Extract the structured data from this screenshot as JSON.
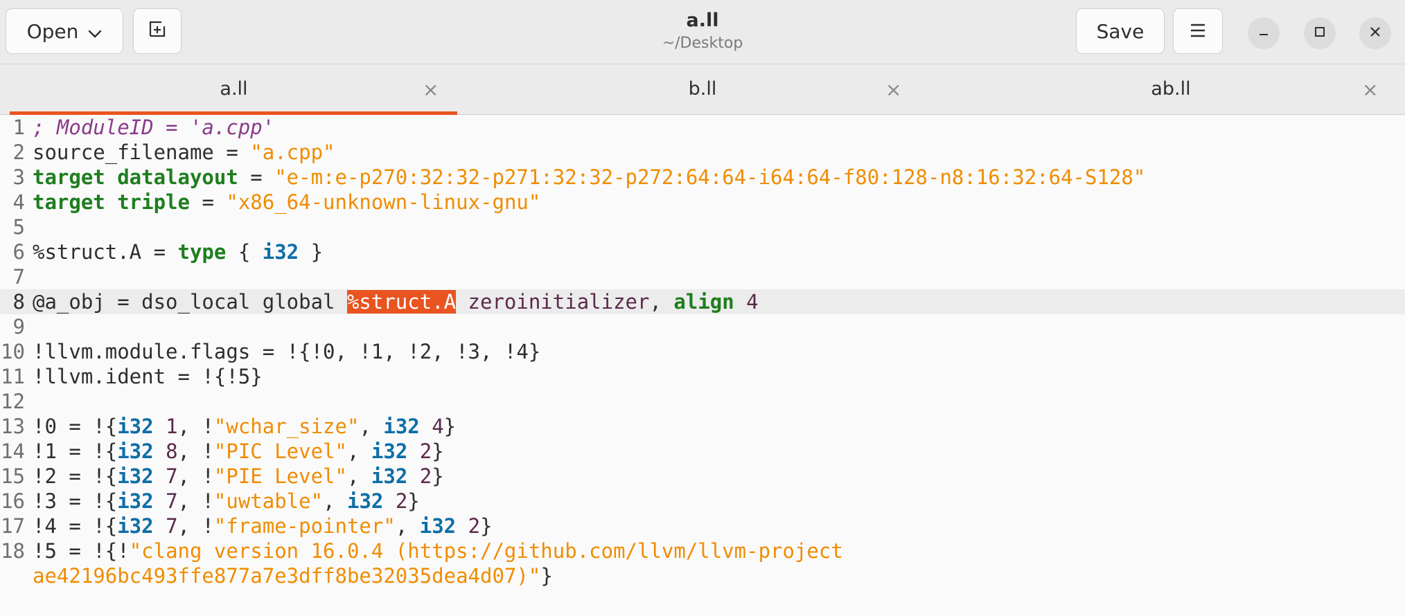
{
  "window": {
    "title": "a.ll",
    "subtitle": "~/Desktop",
    "open_label": "Open",
    "save_label": "Save"
  },
  "tabs": [
    {
      "label": "a.ll",
      "active": true
    },
    {
      "label": "b.ll",
      "active": false
    },
    {
      "label": "ab.ll",
      "active": false
    }
  ],
  "tab_close_glyph": "×",
  "accent_color": "#e95420",
  "current_line": 8,
  "selection_text": "%struct.A",
  "editor": {
    "lines": [
      {
        "n": "1",
        "tokens": [
          {
            "t": "; ModuleID = 'a.cpp'",
            "c": "comment"
          }
        ]
      },
      {
        "n": "2",
        "tokens": [
          {
            "t": "source_filename = ",
            "c": "plain"
          },
          {
            "t": "\"a.cpp\"",
            "c": "str"
          }
        ]
      },
      {
        "n": "3",
        "tokens": [
          {
            "t": "target datalayout",
            "c": "kw"
          },
          {
            "t": " = ",
            "c": "plain"
          },
          {
            "t": "\"e-m:e-p270:32:32-p271:32:32-p272:64:64-i64:64-f80:128-n8:16:32:64-S128\"",
            "c": "str"
          }
        ]
      },
      {
        "n": "4",
        "tokens": [
          {
            "t": "target triple",
            "c": "kw"
          },
          {
            "t": " = ",
            "c": "plain"
          },
          {
            "t": "\"x86_64-unknown-linux-gnu\"",
            "c": "str"
          }
        ]
      },
      {
        "n": "5",
        "tokens": []
      },
      {
        "n": "6",
        "tokens": [
          {
            "t": "%struct.A = ",
            "c": "plain"
          },
          {
            "t": "type",
            "c": "kw"
          },
          {
            "t": " { ",
            "c": "plain"
          },
          {
            "t": "i32",
            "c": "type"
          },
          {
            "t": " }",
            "c": "plain"
          }
        ]
      },
      {
        "n": "7",
        "tokens": []
      },
      {
        "n": "8",
        "tokens": [
          {
            "t": "@a_obj = dso_local global ",
            "c": "plain"
          },
          {
            "t": "%struct.A",
            "c": "sel"
          },
          {
            "t": " zeroinitializer",
            "c": "num"
          },
          {
            "t": ", ",
            "c": "plain"
          },
          {
            "t": "align",
            "c": "kw"
          },
          {
            "t": " 4",
            "c": "num"
          }
        ]
      },
      {
        "n": "9",
        "tokens": []
      },
      {
        "n": "10",
        "tokens": [
          {
            "t": "!llvm.module.flags = !{!0, !1, !2, !3, !4}",
            "c": "plain"
          }
        ]
      },
      {
        "n": "11",
        "tokens": [
          {
            "t": "!llvm.ident = !{!5}",
            "c": "plain"
          }
        ]
      },
      {
        "n": "12",
        "tokens": []
      },
      {
        "n": "13",
        "tokens": [
          {
            "t": "!0 = !{",
            "c": "plain"
          },
          {
            "t": "i32",
            "c": "type"
          },
          {
            "t": " 1",
            "c": "num"
          },
          {
            "t": ", !",
            "c": "plain"
          },
          {
            "t": "\"wchar_size\"",
            "c": "str"
          },
          {
            "t": ", ",
            "c": "plain"
          },
          {
            "t": "i32",
            "c": "type"
          },
          {
            "t": " 4",
            "c": "num"
          },
          {
            "t": "}",
            "c": "plain"
          }
        ]
      },
      {
        "n": "14",
        "tokens": [
          {
            "t": "!1 = !{",
            "c": "plain"
          },
          {
            "t": "i32",
            "c": "type"
          },
          {
            "t": " 8",
            "c": "num"
          },
          {
            "t": ", !",
            "c": "plain"
          },
          {
            "t": "\"PIC Level\"",
            "c": "str"
          },
          {
            "t": ", ",
            "c": "plain"
          },
          {
            "t": "i32",
            "c": "type"
          },
          {
            "t": " 2",
            "c": "num"
          },
          {
            "t": "}",
            "c": "plain"
          }
        ]
      },
      {
        "n": "15",
        "tokens": [
          {
            "t": "!2 = !{",
            "c": "plain"
          },
          {
            "t": "i32",
            "c": "type"
          },
          {
            "t": " 7",
            "c": "num"
          },
          {
            "t": ", !",
            "c": "plain"
          },
          {
            "t": "\"PIE Level\"",
            "c": "str"
          },
          {
            "t": ", ",
            "c": "plain"
          },
          {
            "t": "i32",
            "c": "type"
          },
          {
            "t": " 2",
            "c": "num"
          },
          {
            "t": "}",
            "c": "plain"
          }
        ]
      },
      {
        "n": "16",
        "tokens": [
          {
            "t": "!3 = !{",
            "c": "plain"
          },
          {
            "t": "i32",
            "c": "type"
          },
          {
            "t": " 7",
            "c": "num"
          },
          {
            "t": ", !",
            "c": "plain"
          },
          {
            "t": "\"uwtable\"",
            "c": "str"
          },
          {
            "t": ", ",
            "c": "plain"
          },
          {
            "t": "i32",
            "c": "type"
          },
          {
            "t": " 2",
            "c": "num"
          },
          {
            "t": "}",
            "c": "plain"
          }
        ]
      },
      {
        "n": "17",
        "tokens": [
          {
            "t": "!4 = !{",
            "c": "plain"
          },
          {
            "t": "i32",
            "c": "type"
          },
          {
            "t": " 7",
            "c": "num"
          },
          {
            "t": ", !",
            "c": "plain"
          },
          {
            "t": "\"frame-pointer\"",
            "c": "str"
          },
          {
            "t": ", ",
            "c": "plain"
          },
          {
            "t": "i32",
            "c": "type"
          },
          {
            "t": " 2",
            "c": "num"
          },
          {
            "t": "}",
            "c": "plain"
          }
        ]
      },
      {
        "n": "18",
        "tokens": [
          {
            "t": "!5 = !{!",
            "c": "plain"
          },
          {
            "t": "\"clang version 16.0.4 (https://github.com/llvm/llvm-project",
            "c": "str"
          }
        ]
      },
      {
        "n": "",
        "tokens": [
          {
            "t": "ae42196bc493ffe877a7e3dff8be32035dea4d07)\"",
            "c": "str"
          },
          {
            "t": "}",
            "c": "plain"
          }
        ]
      }
    ]
  }
}
